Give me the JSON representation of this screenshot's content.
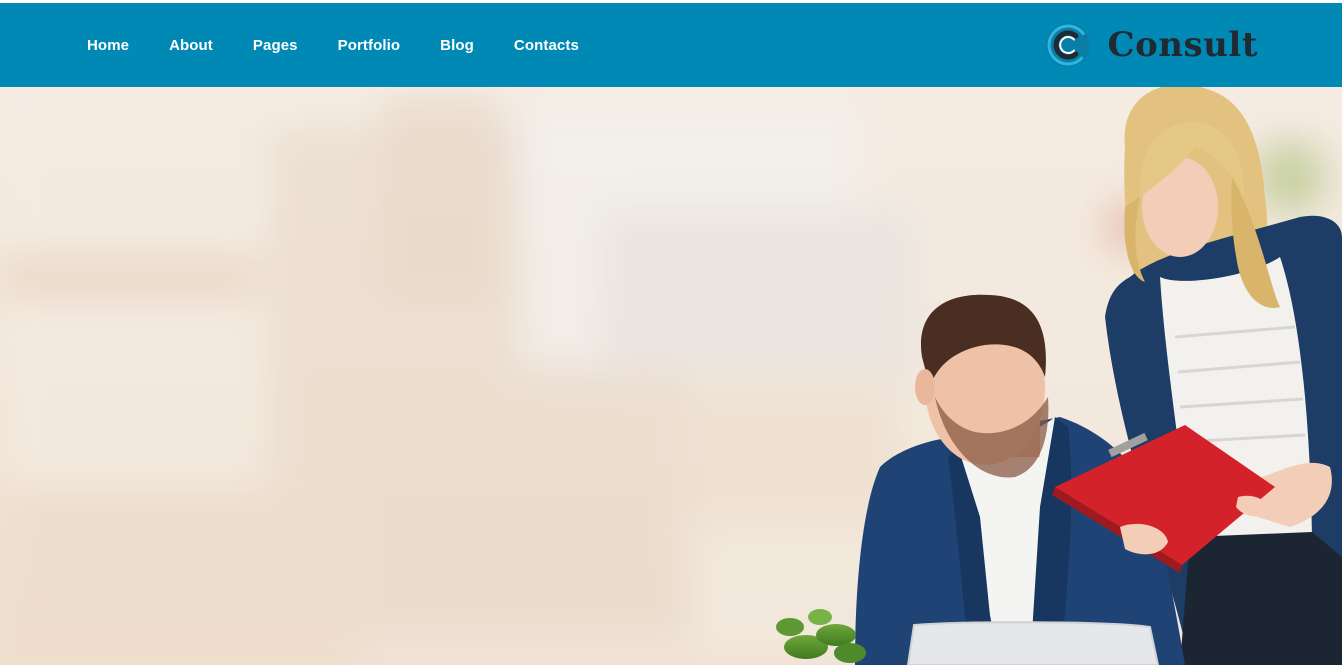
{
  "nav": {
    "items": [
      {
        "label": "Home"
      },
      {
        "label": "About"
      },
      {
        "label": "Pages"
      },
      {
        "label": "Portfolio"
      },
      {
        "label": "Blog"
      },
      {
        "label": "Contacts"
      }
    ]
  },
  "brand": {
    "name": "Consult",
    "logo_icon": "c-letter-logo-icon"
  },
  "hero": {
    "image": "business-people-photo"
  },
  "colors": {
    "navbar_bg": "#0189b6",
    "brand_text": "#1f2a33",
    "nav_text": "#ffffff",
    "logo_ring": "#2fb6e0"
  }
}
